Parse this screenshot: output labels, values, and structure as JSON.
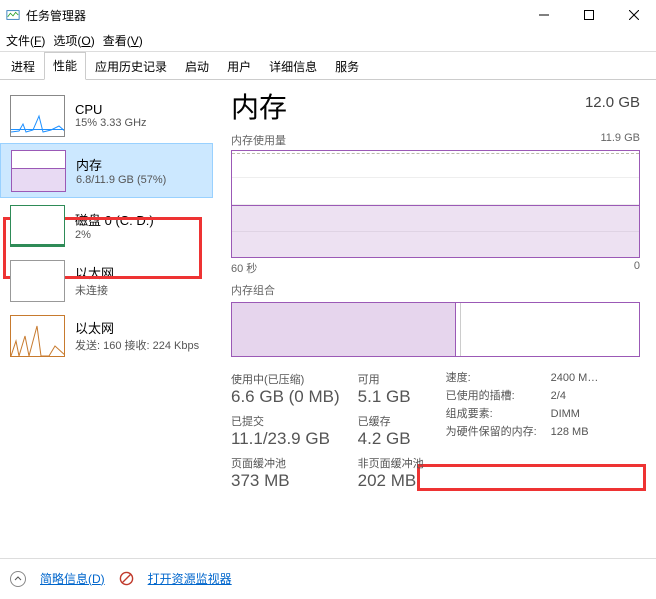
{
  "window": {
    "title": "任务管理器"
  },
  "menu": {
    "file": "文件(F)",
    "options": "选项(O)",
    "view": "查看(V)"
  },
  "tabs": [
    "进程",
    "性能",
    "应用历史记录",
    "启动",
    "用户",
    "详细信息",
    "服务"
  ],
  "active_tab": 1,
  "sidebar": [
    {
      "name": "cpu",
      "title": "CPU",
      "sub": "15% 3.33 GHz",
      "selected": false
    },
    {
      "name": "memory",
      "title": "内存",
      "sub": "6.8/11.9 GB (57%)",
      "selected": true
    },
    {
      "name": "disk",
      "title": "磁盘 0 (C: D:)",
      "sub": "2%",
      "selected": false
    },
    {
      "name": "ethernet1",
      "title": "以太网",
      "sub": "未连接",
      "selected": false
    },
    {
      "name": "ethernet2",
      "title": "以太网",
      "sub": "发送: 160 接收: 224 Kbps",
      "selected": false
    }
  ],
  "main": {
    "title": "内存",
    "capacity": "12.0 GB",
    "usage_label": "内存使用量",
    "usage_max": "11.9 GB",
    "x_left": "60 秒",
    "x_right": "0",
    "composition_label": "内存组合",
    "metrics": {
      "in_use_label": "使用中(已压缩)",
      "in_use_value": "6.6 GB (0 MB)",
      "available_label": "可用",
      "available_value": "5.1 GB",
      "committed_label": "已提交",
      "committed_value": "11.1/23.9 GB",
      "cached_label": "已缓存",
      "cached_value": "4.2 GB",
      "paged_label": "页面缓冲池",
      "paged_value": "373 MB",
      "nonpaged_label": "非页面缓冲池",
      "nonpaged_value": "202 MB"
    },
    "side": {
      "speed_label": "速度:",
      "speed_value": "2400 M…",
      "slots_label": "已使用的插槽:",
      "slots_value": "2/4",
      "form_label": "组成要素:",
      "form_value": "DIMM",
      "reserved_label": "为硬件保留的内存:",
      "reserved_value": "128 MB"
    }
  },
  "footer": {
    "fewer": "简略信息(D)",
    "resmon": "打开资源监视器"
  },
  "chart_data": {
    "type": "area",
    "title": "内存使用量",
    "ylabel": "GB",
    "ylim": [
      0,
      11.9
    ],
    "x_seconds": [
      60,
      0
    ],
    "series": [
      {
        "name": "使用中",
        "approx_constant_value_gb": 6.8
      }
    ],
    "composition": {
      "in_use_gb": 6.6,
      "modified_gb": 0.6,
      "standby_gb": 4.2,
      "free_gb": 0.5,
      "total_gb": 11.9
    }
  }
}
